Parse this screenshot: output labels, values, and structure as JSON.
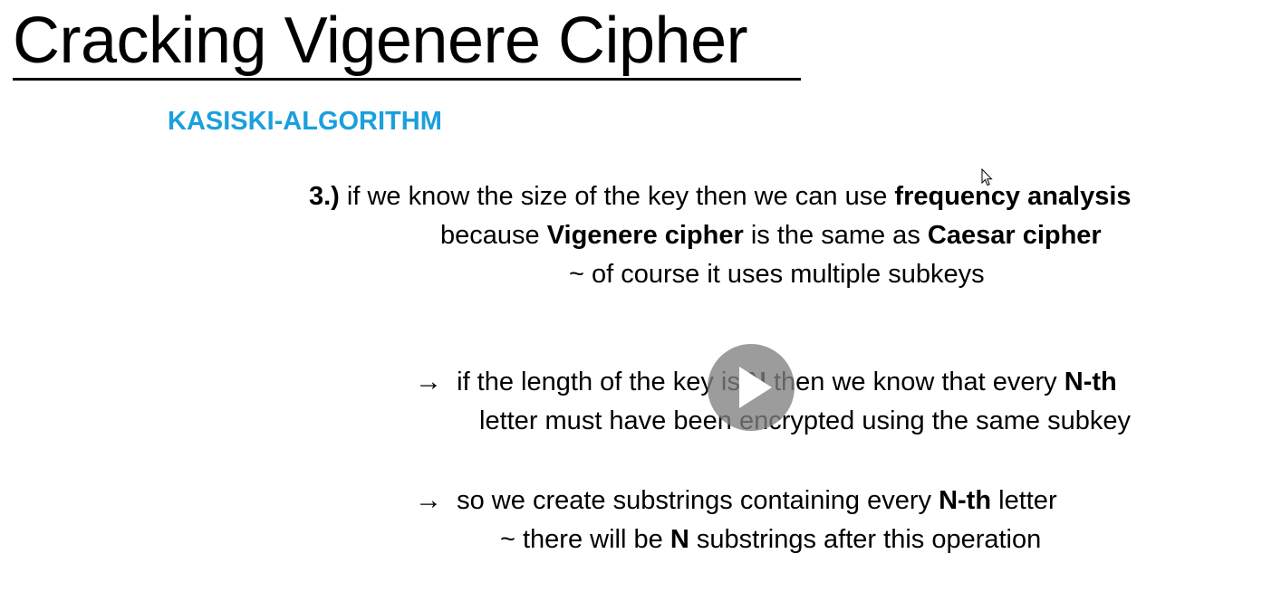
{
  "slide": {
    "title": "Cracking Vigenere Cipher",
    "subtitle": "KASISKI-ALGORITHM",
    "point3": {
      "number": "3.)",
      "line1_a": "if we know the size of the key then we can use",
      "line1_b": "frequency analysis",
      "line2_a": "because",
      "line2_b": "Vigenere cipher",
      "line2_c": "is the same as",
      "line2_d": "Caesar cipher",
      "line3": "~ of course it uses multiple subkeys"
    },
    "bullet1": {
      "arrow": "→",
      "a": "if the length of the key is",
      "b": "N",
      "c": "then we know that every",
      "d": "N-th",
      "line2": "letter must have been encrypted using the same subkey"
    },
    "bullet2": {
      "arrow": "→",
      "a": "so we create substrings containing every",
      "b": "N-th",
      "c": "letter",
      "line2_a": "~ there will be",
      "line2_b": "N",
      "line2_c": "substrings after this operation"
    }
  },
  "overlay": {
    "play_icon": "play-icon",
    "cursor_icon": "mouse-pointer-icon"
  }
}
